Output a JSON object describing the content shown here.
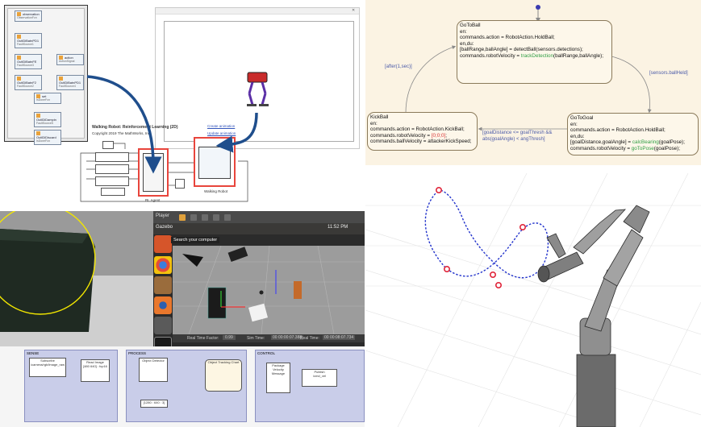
{
  "colors": {
    "stateflow_bg": "#fbf3e3",
    "state_border": "#8a7a5a",
    "transition_label": "#4a5aa8",
    "function_green": "#2f9e44",
    "constant_red": "#d93636",
    "highlight_red": "#e8453c",
    "arrow_blue": "#1f4e8c",
    "trajectory_blue": "#2233cc"
  },
  "simulink": {
    "title": "Walking Robot: Reinforcement Learning (2D)",
    "copyright": "Copyright 2019 The MathWorks, Inc.",
    "link_create": "Create animation",
    "link_update": "Update animation",
    "rl_agent_label": "RL Agent",
    "robot_label": "Walking Robot",
    "list_blocks": [
      {
        "name": "observation",
        "sub": "ObservationFcn"
      },
      {
        "name": "OutlDiBatnPD1",
        "sub": "FaultSource1"
      },
      {
        "name": "OutlDiBatnFE",
        "sub": "FaultSource3"
      },
      {
        "name": "action",
        "sub": "ActionSignal"
      },
      {
        "name": "OutlDiBatnF2",
        "sub": "FaultSource2"
      },
      {
        "name": "OutlDiBatnPD1",
        "sub": "FaultSource4"
      },
      {
        "name": "set",
        "sub": "IsDoneFcn"
      },
      {
        "name": "OutlDiDampin",
        "sub": "FaultSource5"
      },
      {
        "name": "OutlDiDiscard",
        "sub": "IsDoneFcn"
      }
    ]
  },
  "stateflow": {
    "goto_ball": {
      "name": "GoToBall",
      "lines": [
        "en:",
        "commands.action = RobotAction.HoldBall;",
        "en,du:",
        "[ballRange,ballAngle] = detectBall(sensors.detections);"
      ],
      "vel_prefix": "commands.robotVelocity = ",
      "vel_fn": "trackDetection",
      "vel_args": "(ballRange,ballAngle);"
    },
    "kick_ball": {
      "name": "KickBall",
      "lines": [
        "en:",
        "commands.action = RobotAction.KickBall;"
      ],
      "vel_prefix": "commands.robotVelocity = ",
      "vel_const": "[0;0;0]",
      "vel_suffix": ";",
      "last": "commands.ballVelocity = attackerKickSpeed;"
    },
    "goto_goal": {
      "name": "GoToGoal",
      "lines": [
        "en:",
        "commands.action = RobotAction.HoldBall;",
        "en,du:"
      ],
      "bearing_prefix": "[goalDistance,goalAngle] = ",
      "bearing_fn": "calcBearing",
      "bearing_args": "(goalPose);",
      "vel_prefix": "commands.robotVelocity = ",
      "vel_fn": "goToPose",
      "vel_args": "(goalPose);"
    },
    "transitions": {
      "after": "[after(1,sec)]",
      "held": "[sensors.ballHeld]",
      "cond1": "[goalDistance <= goalThresh &&",
      "cond2": " abs(goalAngle) < angThresh]"
    }
  },
  "gazebo": {
    "player_label": "Player",
    "app_title": "Gazebo",
    "clock": "11:52 PM",
    "tooltip": "Search your computer",
    "status": {
      "rtf_label": "Real Time Factor:",
      "rtf_value": "0.99",
      "sim_label": "Sim Time:",
      "sim_value": "00 00:00:07.388",
      "real_label": "Real Time:",
      "real_value": "00 00:08:07.734"
    }
  },
  "ros_model": {
    "sense_title": "SENSE",
    "process_title": "PROCESS",
    "control_title": "CONTROL",
    "subscribe": "Subscribe",
    "read_image": "Read Image",
    "object_detector": "Object Detector",
    "tracking_chart": "Object Tracking Chart",
    "package_msg": "Package Velocity Message",
    "publish": "Publish",
    "topic_in": "/camera/rgb/image_raw",
    "topic_out": "/cmd_vel",
    "image_fmt": "[480 640] : fcp16",
    "pos_vec": "[1280 : 640 : 3]"
  }
}
